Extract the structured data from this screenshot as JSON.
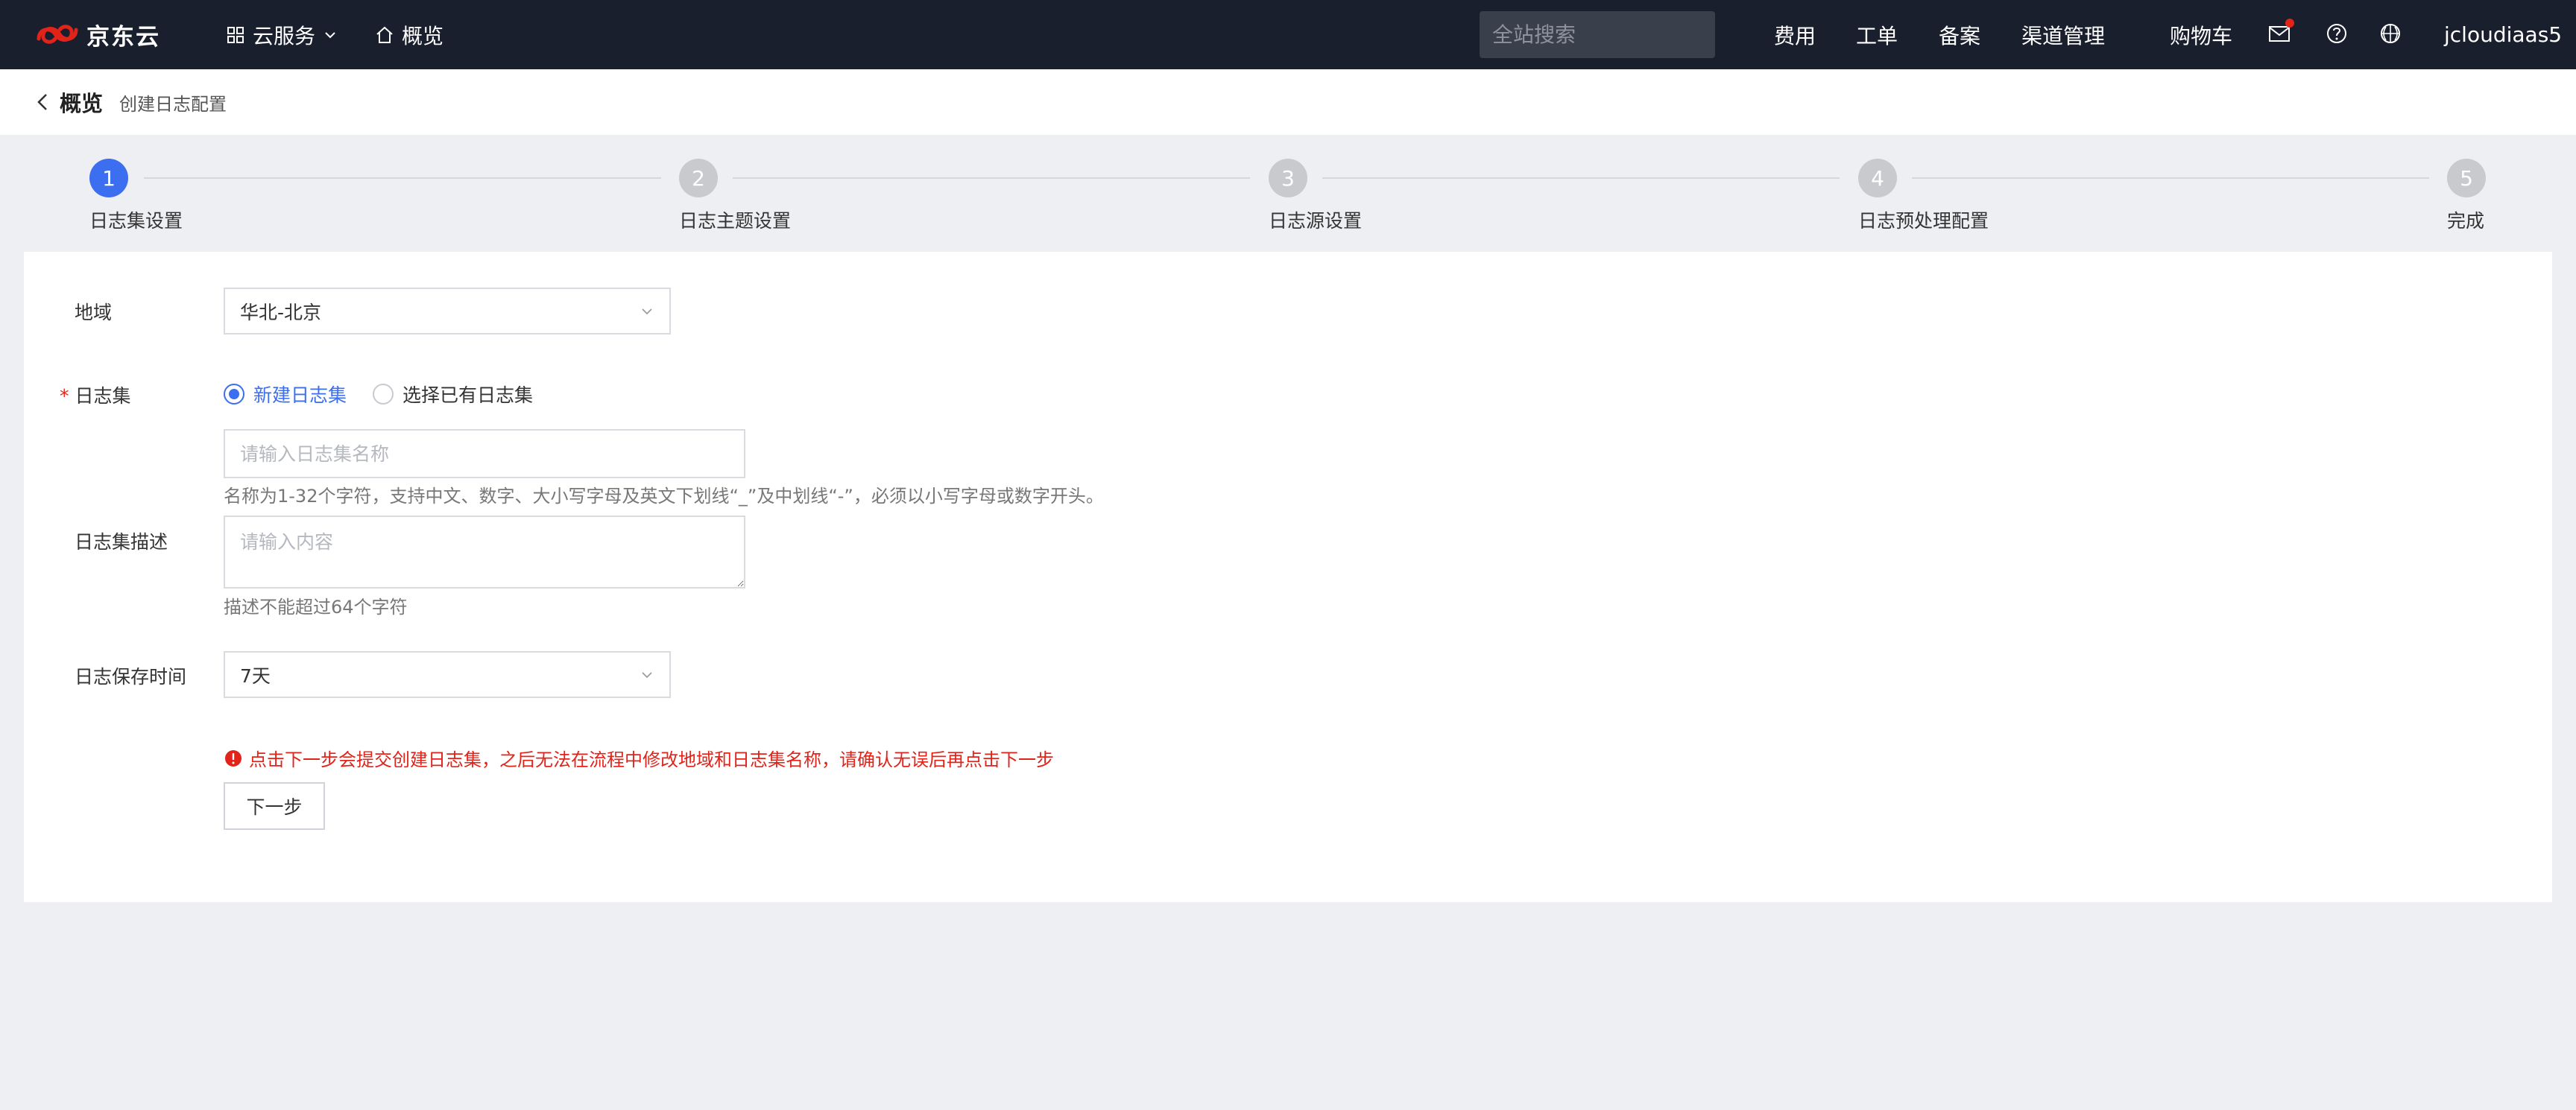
{
  "topbar": {
    "brand": "京东云",
    "cloud_services": "云服务",
    "overview": "概览",
    "search_placeholder": "全站搜索",
    "nav": [
      "费用",
      "工单",
      "备案",
      "渠道管理",
      "购物车"
    ],
    "username": "jcloudiaas5",
    "icons": [
      "mail-icon",
      "help-icon",
      "language-icon"
    ]
  },
  "breadcrumb": {
    "parent": "概览",
    "current": "创建日志配置"
  },
  "steps": [
    {
      "number": "1",
      "label": "日志集设置",
      "active": true
    },
    {
      "number": "2",
      "label": "日志主题设置",
      "active": false
    },
    {
      "number": "3",
      "label": "日志源设置",
      "active": false
    },
    {
      "number": "4",
      "label": "日志预处理配置",
      "active": false
    },
    {
      "number": "5",
      "label": "完成",
      "active": false
    }
  ],
  "form": {
    "region_label": "地域",
    "region_value": "华北-北京",
    "logset_label": "日志集",
    "logset_required_mark": "*",
    "radio_new": "新建日志集",
    "radio_existing": "选择已有日志集",
    "name_placeholder": "请输入日志集名称",
    "name_hint": "名称为1-32个字符，支持中文、数字、大小写字母及英文下划线“_”及中划线“-”，必须以小写字母或数字开头。",
    "desc_label": "日志集描述",
    "desc_placeholder": "请输入内容",
    "desc_hint": "描述不能超过64个字符",
    "retention_label": "日志保存时间",
    "retention_value": "7天",
    "warning": "点击下一步会提交创建日志集，之后无法在流程中修改地域和日志集名称，请确认无误后再点击下一步",
    "next_button": "下一步"
  },
  "colors": {
    "topbar_bg": "#1a1f2e",
    "accent": "#3c6ef0",
    "danger": "#e2231a",
    "page_bg": "#eeeff3"
  }
}
